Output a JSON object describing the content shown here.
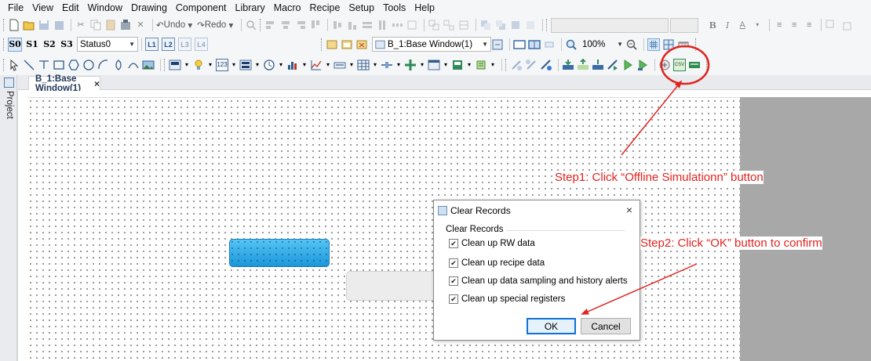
{
  "menu": [
    "File",
    "View",
    "Edit",
    "Window",
    "Drawing",
    "Component",
    "Library",
    "Macro",
    "Recipe",
    "Setup",
    "Tools",
    "Help"
  ],
  "toolbar1": {
    "undo_label": "Undo",
    "redo_label": "Redo",
    "format_icons": [
      "bold-icon",
      "italic-icon",
      "font-color-icon",
      "align-left-icon",
      "align-center-icon",
      "align-right-icon"
    ]
  },
  "toolbar2": {
    "state_buttons": [
      "S0",
      "S1",
      "S2",
      "S3"
    ],
    "status_select": "Status0",
    "layer_buttons": [
      "L1",
      "L2",
      "L3",
      "L4"
    ],
    "window_select": "B_1:Base Window(1)",
    "zoom": "100%"
  },
  "toolbar3": {
    "icons": [
      "select-arrow-icon",
      "line-icon",
      "polyline-icon",
      "rectangle-icon",
      "rounded-rect-icon",
      "ellipse-icon",
      "arc-icon",
      "polygon-icon",
      "freeform-icon",
      "picture-icon",
      "bit-button-icon",
      "bit-lamp-icon",
      "numeric-icon",
      "word-button-icon",
      "clock-icon",
      "bar-graph-icon",
      "trend-icon",
      "keyboard-icon",
      "table-icon",
      "slider-icon",
      "move-icon",
      "window-icon",
      "alarm-icon",
      "recipe-icon",
      "online-simulation-icon",
      "offline-simulation-icon",
      "compile-icon",
      "download-icon",
      "upload-icon",
      "offline-simulation-play-icon",
      "online-play-icon",
      "debug-icon",
      "csv-icon",
      "plc-icon"
    ]
  },
  "side_panel": {
    "label": "Project"
  },
  "document_tab": {
    "label": "B_1:Base Window(1)",
    "close": "×"
  },
  "dialog": {
    "title": "Clear Records",
    "close": "×",
    "group_label": "Clear Records",
    "options": [
      {
        "label": "Clean up RW data",
        "checked": true
      },
      {
        "label": "Clean up recipe data",
        "checked": true
      },
      {
        "label": "Clean up data sampling and history alerts",
        "checked": true
      },
      {
        "label": "Clean up special registers",
        "checked": true
      }
    ],
    "ok_label": "OK",
    "cancel_label": "Cancel"
  },
  "annotations": {
    "step1": "Step1: Click “Offline Simulationn” button",
    "step2": "Step2: Click “OK” button to confirm",
    "color": "#e0231f"
  },
  "colors": {
    "accent_blue": "#1a95d9",
    "ok_border": "#0d73d4",
    "toolbar_bg": "#f5f6f7"
  }
}
